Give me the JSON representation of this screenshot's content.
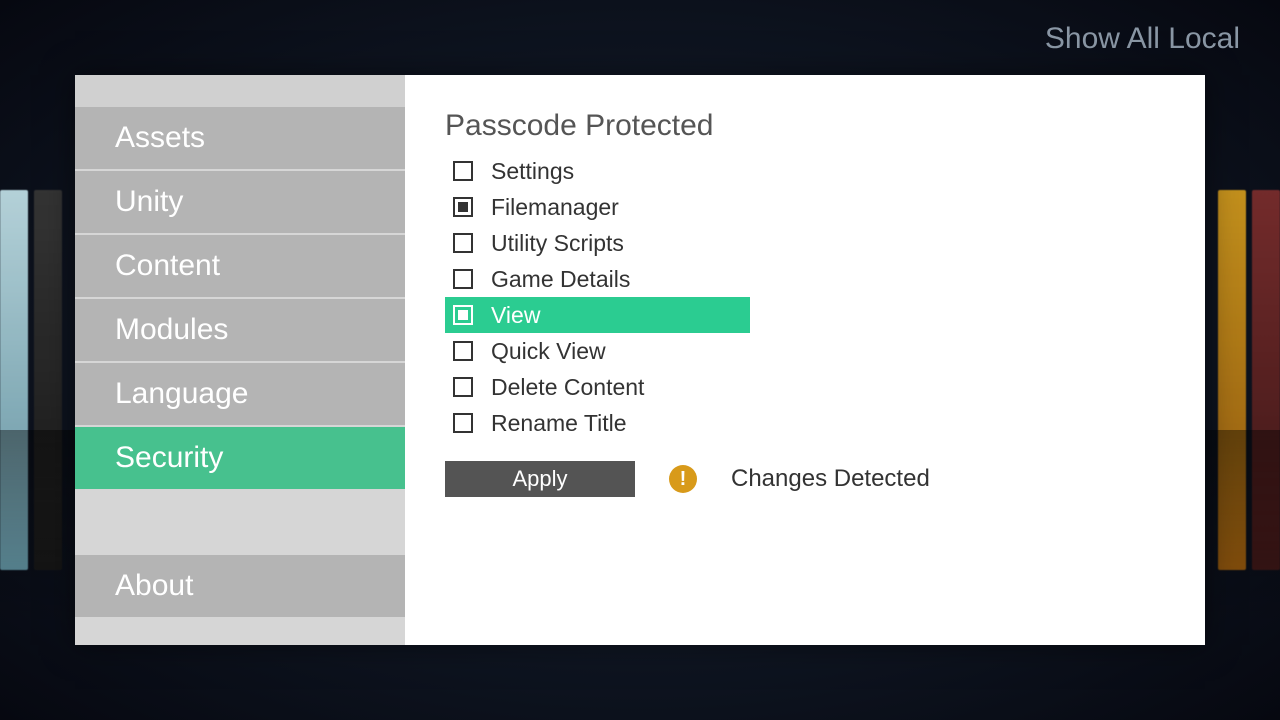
{
  "top_label": "Show All Local",
  "sidebar": {
    "items": [
      {
        "label": "Assets",
        "selected": false
      },
      {
        "label": "Unity",
        "selected": false
      },
      {
        "label": "Content",
        "selected": false
      },
      {
        "label": "Modules",
        "selected": false
      },
      {
        "label": "Language",
        "selected": false
      },
      {
        "label": "Security",
        "selected": true
      }
    ],
    "about_label": "About"
  },
  "content": {
    "title": "Passcode Protected",
    "checks": [
      {
        "label": "Settings",
        "checked": false,
        "highlight": false
      },
      {
        "label": "Filemanager",
        "checked": true,
        "highlight": false
      },
      {
        "label": "Utility Scripts",
        "checked": false,
        "highlight": false
      },
      {
        "label": "Game Details",
        "checked": false,
        "highlight": false
      },
      {
        "label": "View",
        "checked": true,
        "highlight": true
      },
      {
        "label": "Quick View",
        "checked": false,
        "highlight": false
      },
      {
        "label": "Delete Content",
        "checked": false,
        "highlight": false
      },
      {
        "label": "Rename Title",
        "checked": false,
        "highlight": false
      }
    ],
    "apply_label": "Apply",
    "status_text": "Changes Detected",
    "warn_glyph": "!"
  },
  "colors": {
    "accent": "#47c18e",
    "highlight": "#2bcc91",
    "warn": "#d89a1a"
  }
}
